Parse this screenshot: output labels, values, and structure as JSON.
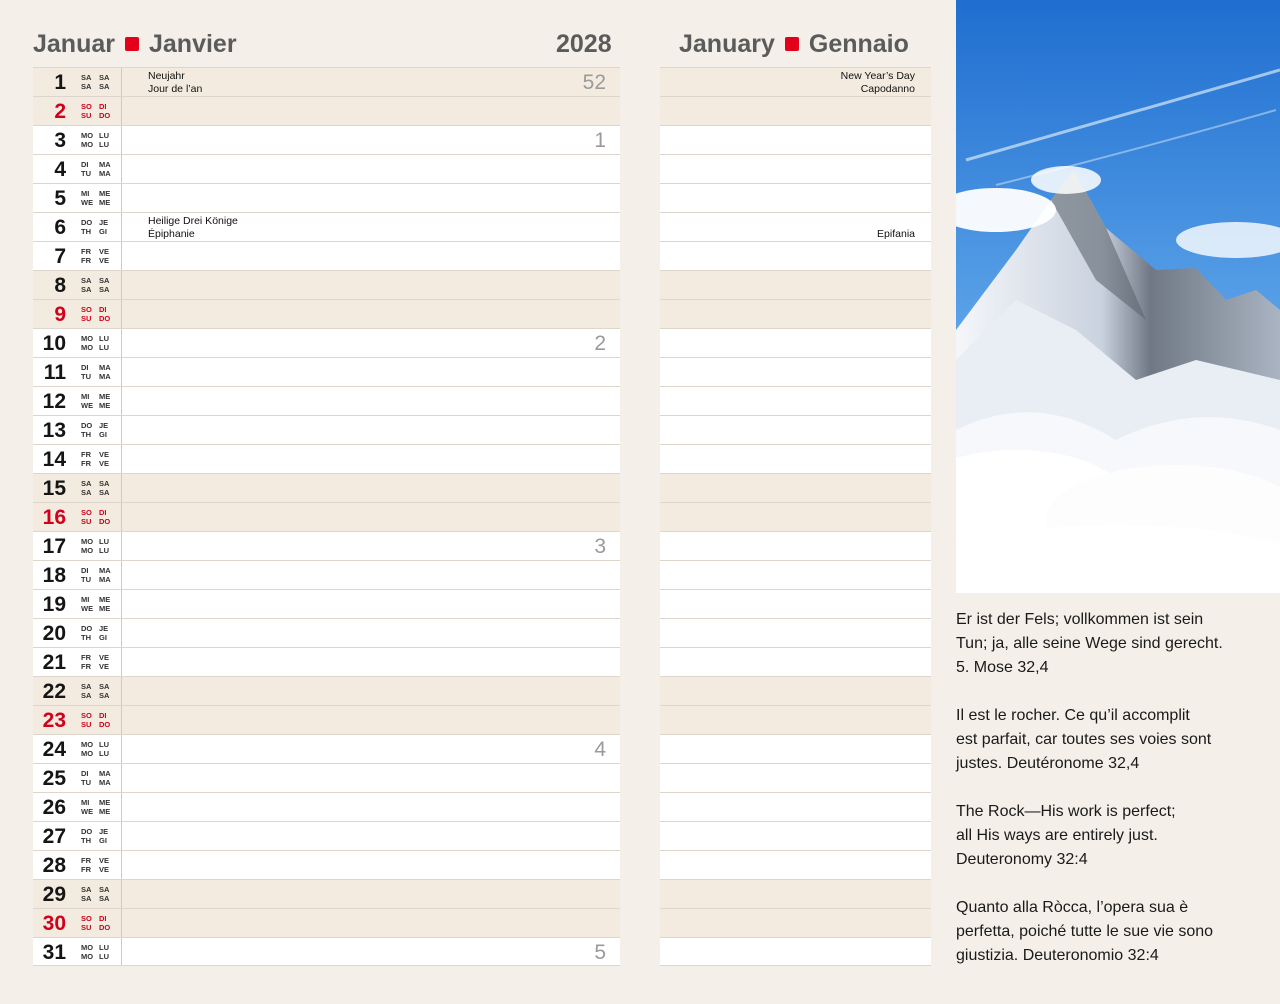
{
  "header": {
    "left_de": "Januar",
    "left_fr": "Janvier",
    "year": "2028",
    "right_en": "January",
    "right_it": "Gennaio"
  },
  "days": [
    {
      "n": "1",
      "w": [
        "SA",
        "SA",
        "SA",
        "SA"
      ],
      "t": "sat",
      "hol_left": [
        "Neujahr",
        "Jour de l’an"
      ],
      "hol_right": [
        "New Year’s Day",
        "Capodanno"
      ],
      "week": "52"
    },
    {
      "n": "2",
      "w": [
        "SO",
        "DI",
        "SU",
        "DO"
      ],
      "t": "sun"
    },
    {
      "n": "3",
      "w": [
        "MO",
        "LU",
        "MO",
        "LU"
      ],
      "t": "wk",
      "week": "1"
    },
    {
      "n": "4",
      "w": [
        "DI",
        "MA",
        "TU",
        "MA"
      ],
      "t": "wk"
    },
    {
      "n": "5",
      "w": [
        "MI",
        "ME",
        "WE",
        "ME"
      ],
      "t": "wk"
    },
    {
      "n": "6",
      "w": [
        "DO",
        "JE",
        "TH",
        "GI"
      ],
      "t": "wk",
      "hol_left": [
        "Heilige Drei Könige",
        "Épiphanie"
      ],
      "hol_right": [
        "",
        "Epifania"
      ]
    },
    {
      "n": "7",
      "w": [
        "FR",
        "VE",
        "FR",
        "VE"
      ],
      "t": "wk"
    },
    {
      "n": "8",
      "w": [
        "SA",
        "SA",
        "SA",
        "SA"
      ],
      "t": "sat"
    },
    {
      "n": "9",
      "w": [
        "SO",
        "DI",
        "SU",
        "DO"
      ],
      "t": "sun"
    },
    {
      "n": "10",
      "w": [
        "MO",
        "LU",
        "MO",
        "LU"
      ],
      "t": "wk",
      "week": "2"
    },
    {
      "n": "11",
      "w": [
        "DI",
        "MA",
        "TU",
        "MA"
      ],
      "t": "wk"
    },
    {
      "n": "12",
      "w": [
        "MI",
        "ME",
        "WE",
        "ME"
      ],
      "t": "wk"
    },
    {
      "n": "13",
      "w": [
        "DO",
        "JE",
        "TH",
        "GI"
      ],
      "t": "wk"
    },
    {
      "n": "14",
      "w": [
        "FR",
        "VE",
        "FR",
        "VE"
      ],
      "t": "wk"
    },
    {
      "n": "15",
      "w": [
        "SA",
        "SA",
        "SA",
        "SA"
      ],
      "t": "sat"
    },
    {
      "n": "16",
      "w": [
        "SO",
        "DI",
        "SU",
        "DO"
      ],
      "t": "sun"
    },
    {
      "n": "17",
      "w": [
        "MO",
        "LU",
        "MO",
        "LU"
      ],
      "t": "wk",
      "week": "3"
    },
    {
      "n": "18",
      "w": [
        "DI",
        "MA",
        "TU",
        "MA"
      ],
      "t": "wk"
    },
    {
      "n": "19",
      "w": [
        "MI",
        "ME",
        "WE",
        "ME"
      ],
      "t": "wk"
    },
    {
      "n": "20",
      "w": [
        "DO",
        "JE",
        "TH",
        "GI"
      ],
      "t": "wk"
    },
    {
      "n": "21",
      "w": [
        "FR",
        "VE",
        "FR",
        "VE"
      ],
      "t": "wk"
    },
    {
      "n": "22",
      "w": [
        "SA",
        "SA",
        "SA",
        "SA"
      ],
      "t": "sat"
    },
    {
      "n": "23",
      "w": [
        "SO",
        "DI",
        "SU",
        "DO"
      ],
      "t": "sun"
    },
    {
      "n": "24",
      "w": [
        "MO",
        "LU",
        "MO",
        "LU"
      ],
      "t": "wk",
      "week": "4"
    },
    {
      "n": "25",
      "w": [
        "DI",
        "MA",
        "TU",
        "MA"
      ],
      "t": "wk"
    },
    {
      "n": "26",
      "w": [
        "MI",
        "ME",
        "WE",
        "ME"
      ],
      "t": "wk"
    },
    {
      "n": "27",
      "w": [
        "DO",
        "JE",
        "TH",
        "GI"
      ],
      "t": "wk"
    },
    {
      "n": "28",
      "w": [
        "FR",
        "VE",
        "FR",
        "VE"
      ],
      "t": "wk"
    },
    {
      "n": "29",
      "w": [
        "SA",
        "SA",
        "SA",
        "SA"
      ],
      "t": "sat"
    },
    {
      "n": "30",
      "w": [
        "SO",
        "DI",
        "SU",
        "DO"
      ],
      "t": "sun"
    },
    {
      "n": "31",
      "w": [
        "MO",
        "LU",
        "MO",
        "LU"
      ],
      "t": "wk",
      "week": "5"
    }
  ],
  "verses": [
    [
      "Er ist der Fels; vollkommen ist sein",
      "Tun; ja, alle seine Wege sind gerecht.",
      "5. Mose 32,4"
    ],
    [
      "Il est le rocher. Ce qu’il accomplit",
      "est parfait, car toutes ses voies sont",
      "justes.   Deutéronome 32,4"
    ],
    [
      "The Rock—His work is perfect;",
      "all His ways are entirely just.",
      "Deuteronomy 32:4"
    ],
    [
      "Quanto alla Ròcca, l’opera sua è",
      "perfetta, poiché tutte le sue vie sono",
      "giustizia.   Deuteronomio 32:4"
    ]
  ]
}
